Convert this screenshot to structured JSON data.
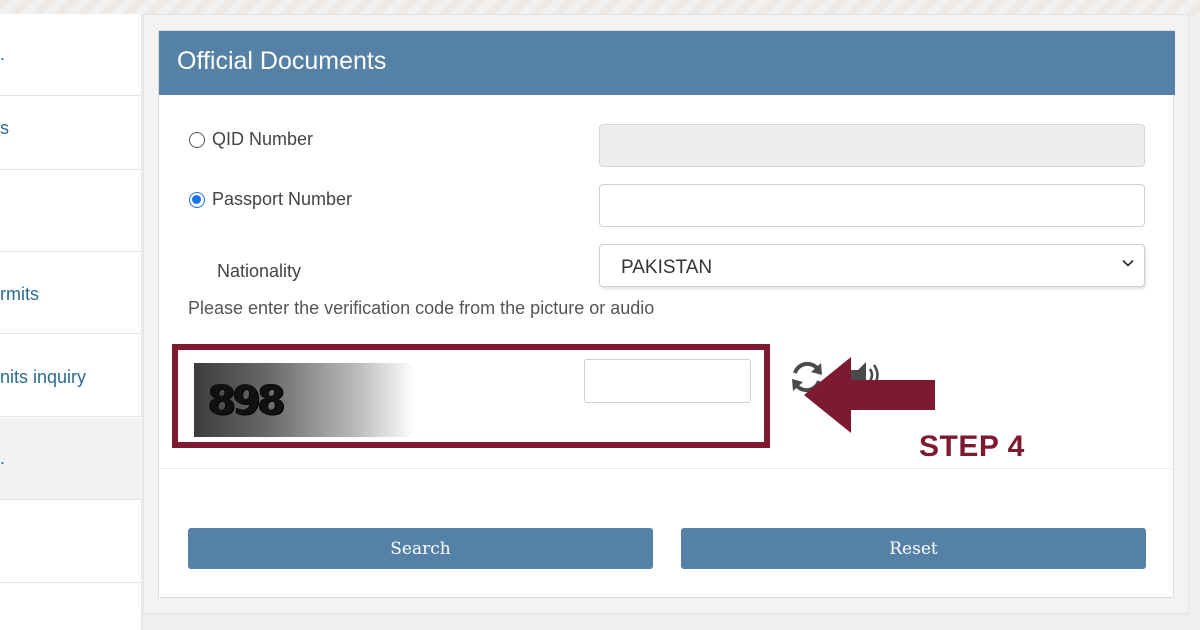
{
  "sidebar": {
    "items": [
      {
        "label": "."
      },
      {
        "label": "s"
      },
      {
        "label": ""
      },
      {
        "label": "rmits"
      },
      {
        "label": "nits inquiry"
      },
      {
        "label": "."
      },
      {
        "label": ""
      }
    ]
  },
  "form": {
    "title": "Official Documents",
    "qid_label": "QID Number",
    "passport_label": "Passport Number",
    "selected_option": "Passport Number",
    "nationality_label": "Nationality",
    "nationality_value": "PAKISTAN",
    "verification_prompt": "Please enter the verification code from the picture or audio",
    "captcha_code": "898",
    "search_label": "Search",
    "reset_label": "Reset"
  },
  "annotation": {
    "step_label": "STEP 4",
    "color": "#7e1932"
  },
  "colors": {
    "header": "#5581a6",
    "button": "#5581a6",
    "radio_selected": "#1a73e8",
    "link": "#2a6d8f"
  },
  "icons": [
    "refresh-icon",
    "audio-icon",
    "chevron-down-icon",
    "arrow-left-icon"
  ]
}
